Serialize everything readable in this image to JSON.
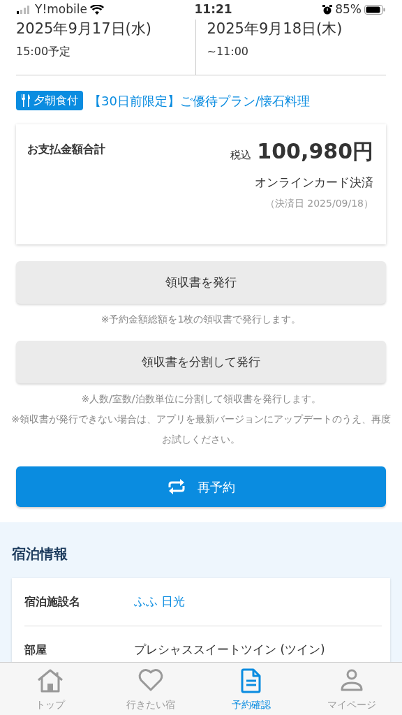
{
  "status_bar": {
    "carrier": "Y!mobile",
    "time": "11:21",
    "battery": "85%"
  },
  "stay": {
    "checkin_date": "2025年9月17日(水)",
    "checkin_time": "15:00予定",
    "checkout_date": "2025年9月18日(木)",
    "checkout_time": "~11:00"
  },
  "plan": {
    "meal_badge": "夕朝食付",
    "name": "【30日前限定】ご優待プラン/懐石料理"
  },
  "payment": {
    "label": "お支払金額合計",
    "tax_label": "税込",
    "amount": "100,980円",
    "method": "オンラインカード決済",
    "date": "（決済日 2025/09/18）"
  },
  "receipt_button": "領収書を発行",
  "receipt_note": "※予約金額総額を1枚の領収書で発行します。",
  "split_button": "領収書を分割して発行",
  "split_notes": [
    "※人数/室数/泊数単位に分割して領収書を発行します。",
    "※領収書が発行できない場合は、アプリを最新バージョンにアップデートのうえ、再度お試しください。"
  ],
  "rebook_button": "再予約",
  "section": {
    "title": "宿泊情報",
    "rows": [
      {
        "label": "宿泊施設名",
        "value": "ふふ 日光",
        "kind": "link"
      },
      {
        "label": "部屋",
        "value": "プレシャススイートツイン (ツイン)",
        "kind": "text"
      }
    ]
  },
  "tabs": [
    {
      "label": "トップ",
      "selected": false,
      "kind": "home"
    },
    {
      "label": "行きたい宿",
      "selected": false,
      "kind": "heart"
    },
    {
      "label": "予約確認",
      "selected": true,
      "kind": "doc"
    },
    {
      "label": "マイページ",
      "selected": false,
      "kind": "person"
    }
  ]
}
